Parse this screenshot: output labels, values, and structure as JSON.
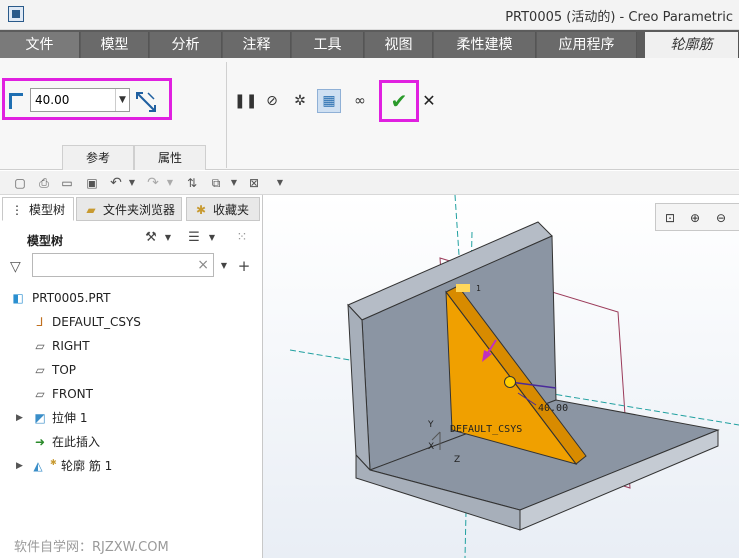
{
  "window": {
    "title": "PRT0005 (活动的) - Creo Parametric"
  },
  "tabs": [
    {
      "label": "文件"
    },
    {
      "label": "模型"
    },
    {
      "label": "分析"
    },
    {
      "label": "注释"
    },
    {
      "label": "工具"
    },
    {
      "label": "视图"
    },
    {
      "label": "柔性建模"
    },
    {
      "label": "应用程序"
    },
    {
      "label": "轮廓筋"
    }
  ],
  "ribbon": {
    "width_value": "40.00",
    "subtabs": [
      "参考",
      "属性"
    ],
    "ok_glyph": "✔",
    "cancel_glyph": "✕"
  },
  "panel": {
    "tabs": [
      "模型树",
      "文件夹浏览器",
      "收藏夹"
    ],
    "tree_title": "模型树",
    "search_placeholder": ""
  },
  "tree": [
    {
      "label": "PRT0005.PRT",
      "icon": "part-icon",
      "expandable": false
    },
    {
      "label": "DEFAULT_CSYS",
      "icon": "csys-icon",
      "expandable": false
    },
    {
      "label": "RIGHT",
      "icon": "plane-icon",
      "expandable": false
    },
    {
      "label": "TOP",
      "icon": "plane-icon",
      "expandable": false
    },
    {
      "label": "FRONT",
      "icon": "plane-icon",
      "expandable": false
    },
    {
      "label": "拉伸 1",
      "icon": "extrude-icon",
      "expandable": true
    },
    {
      "label": "在此插入",
      "icon": "insert-arrow-icon",
      "expandable": false
    },
    {
      "label": "轮廓 筋 1",
      "icon": "rib-icon",
      "expandable": true
    }
  ],
  "viewport": {
    "dimension_label": "40.00",
    "csys_label": "DEFAULT_CSYS",
    "rib_label": "1",
    "axis_labels": [
      "Y",
      "X",
      "Z"
    ]
  },
  "watermark": "软件自学网：RJZXW.COM",
  "colors": {
    "highlight": "#e020e0",
    "rib_fill": "#f0a000",
    "part_fill": "#8b95a3",
    "ok_green": "#2a9a2a"
  }
}
